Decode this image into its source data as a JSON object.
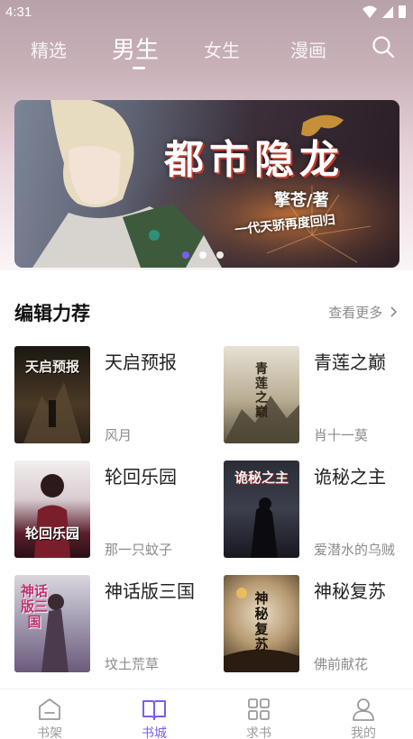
{
  "status": {
    "time": "4:31"
  },
  "tabs": [
    {
      "label": "精选"
    },
    {
      "label": "男生"
    },
    {
      "label": "女生"
    },
    {
      "label": "漫画"
    }
  ],
  "banner": {
    "title": "都市隐龙",
    "author": "擎苍/著",
    "tagline": "一代天骄再度回归",
    "slides": 3,
    "active_slide": 1
  },
  "section": {
    "title": "编辑力荐",
    "more": "查看更多"
  },
  "books": [
    {
      "title": "天启预报",
      "author": "风月",
      "cover_text": "天启预报"
    },
    {
      "title": "青莲之巅",
      "author": "肖十一莫",
      "cover_text": "青莲之巅"
    },
    {
      "title": "轮回乐园",
      "author": "那一只蚊子",
      "cover_text": "轮回乐园"
    },
    {
      "title": "诡秘之主",
      "author": "爱潜水的乌贼",
      "cover_text": "诡秘之主"
    },
    {
      "title": "神话版三国",
      "author": "坟土荒草",
      "cover_text": "神话版三国"
    },
    {
      "title": "神秘复苏",
      "author": "佛前献花",
      "cover_text": "神秘复苏"
    }
  ],
  "bottom_nav": [
    {
      "label": "书架",
      "icon": "bookshelf-icon"
    },
    {
      "label": "书城",
      "icon": "book-open-icon"
    },
    {
      "label": "求书",
      "icon": "grid-icon"
    },
    {
      "label": "我的",
      "icon": "user-icon"
    }
  ],
  "colors": {
    "accent": "#7b5cf0",
    "muted_text": "#8b8b8b"
  }
}
